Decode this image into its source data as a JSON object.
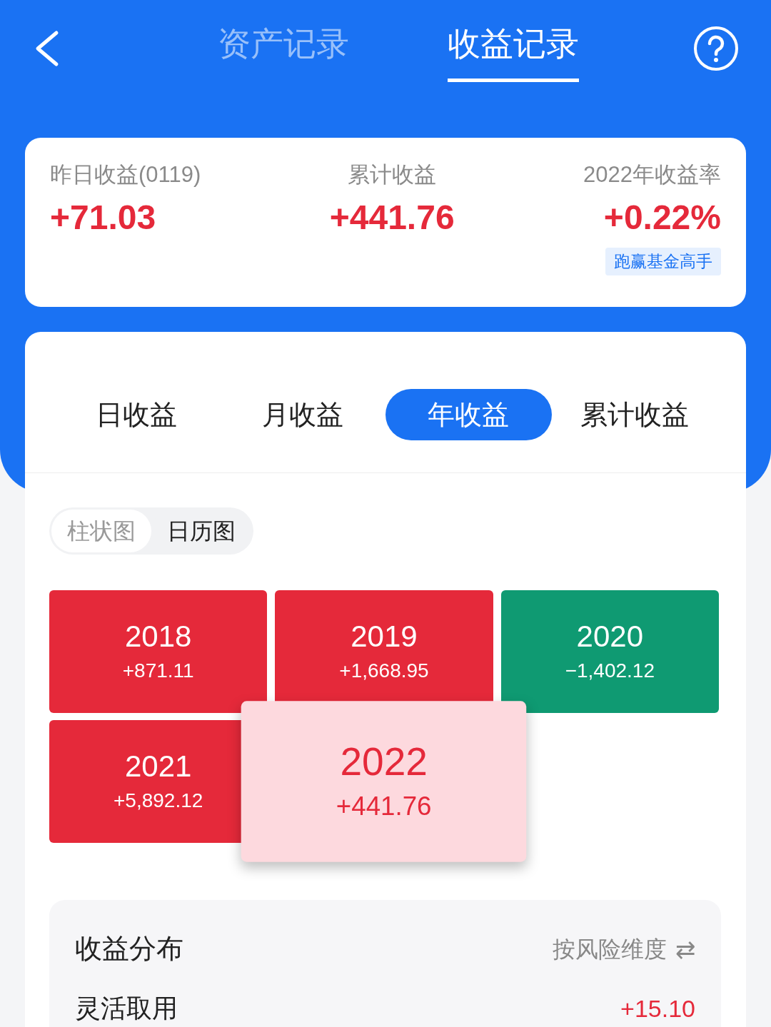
{
  "top_tabs": [
    {
      "label": "资产记录",
      "selected": false
    },
    {
      "label": "收益记录",
      "selected": true
    }
  ],
  "summary": [
    {
      "label": "昨日收益(0119)",
      "value": "+71.03"
    },
    {
      "label": "累计收益",
      "value": "+441.76"
    },
    {
      "label": "2022年收益率",
      "value": "+0.22%",
      "badge": "跑赢基金高手"
    }
  ],
  "period_tabs": [
    {
      "label": "日收益",
      "selected": false
    },
    {
      "label": "月收益",
      "selected": false
    },
    {
      "label": "年收益",
      "selected": true
    },
    {
      "label": "累计收益",
      "selected": false
    }
  ],
  "view_toggle": [
    {
      "label": "柱状图",
      "selected": false
    },
    {
      "label": "日历图",
      "selected": true
    }
  ],
  "year_tiles": [
    {
      "year": "2018",
      "value": "+871.11",
      "color": "#e5293a",
      "selected": false
    },
    {
      "year": "2019",
      "value": "+1,668.95",
      "color": "#e5293a",
      "selected": false
    },
    {
      "year": "2020",
      "value": "−1,402.12",
      "color": "#0f9a72",
      "selected": false
    },
    {
      "year": "2021",
      "value": "+5,892.12",
      "color": "#e5293a",
      "selected": false
    },
    {
      "year": "2022",
      "value": "+441.76",
      "color": "#e5293a",
      "selected": true
    }
  ],
  "distribution": {
    "title": "收益分布",
    "switch_label": "按风险维度",
    "switch_icon": "⇄",
    "rows": [
      {
        "label": "灵活取用",
        "value": "+15.10"
      }
    ]
  }
}
